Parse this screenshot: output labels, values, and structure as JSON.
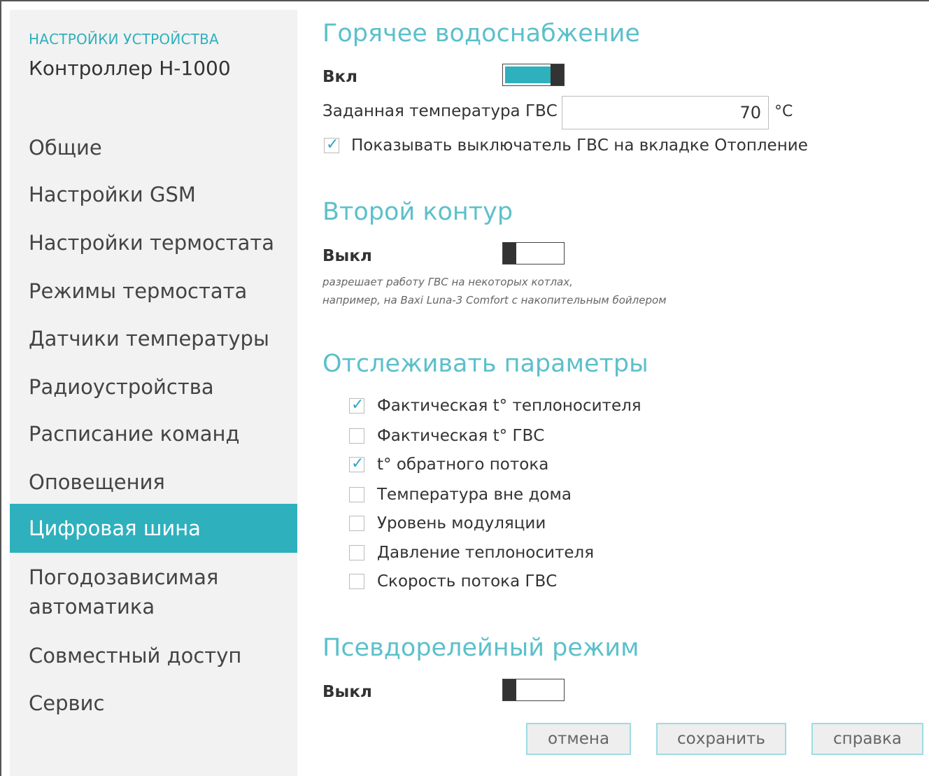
{
  "sidebar": {
    "caption": "НАСТРОЙКИ УСТРОЙСТВА",
    "device": "Контроллер H-1000",
    "items": [
      {
        "label": "Общие"
      },
      {
        "label": "Настройки GSM"
      },
      {
        "label": "Настройки термостата"
      },
      {
        "label": "Режимы термостата"
      },
      {
        "label": "Датчики температуры"
      },
      {
        "label": "Радиоустройства"
      },
      {
        "label": "Расписание команд"
      },
      {
        "label": "Оповещения"
      },
      {
        "label": "Цифровая шина"
      },
      {
        "label_line1": "Погодозависимая",
        "label_line2": "автоматика"
      },
      {
        "label": "Совместный доступ"
      },
      {
        "label": "Сервис"
      }
    ],
    "active_index": 8
  },
  "hot_water": {
    "title": "Горячее водоснабжение",
    "state_label": "Вкл",
    "toggle_on": true,
    "temp_label": "Заданная температура ГВС",
    "temp_value": "70",
    "temp_unit": "°C",
    "show_switch_checked": true,
    "show_switch_label": "Показывать выключатель ГВС на вкладке Отопление"
  },
  "second_circuit": {
    "title": "Второй контур",
    "state_label": "Выкл",
    "toggle_on": false,
    "note_line1": "разрешает работу ГВС на некоторых котлах,",
    "note_line2": "например, на Baxi Luna-3 Comfort с накопительным бойлером"
  },
  "monitor": {
    "title": "Отслеживать параметры",
    "items": [
      {
        "label": "Фактическая t° теплоносителя",
        "checked": true
      },
      {
        "label": "Фактическая t° ГВС",
        "checked": false
      },
      {
        "label": "t° обратного потока",
        "checked": true
      },
      {
        "label": "Температура вне дома",
        "checked": false
      },
      {
        "label": "Уровень модуляции",
        "checked": false
      },
      {
        "label": "Давление теплоносителя",
        "checked": false
      },
      {
        "label": "Скорость потока ГВС",
        "checked": false
      }
    ]
  },
  "pseudo_relay": {
    "title": "Псевдорелейный режим",
    "state_label": "Выкл",
    "toggle_on": false
  },
  "buttons": {
    "cancel": "отмена",
    "save": "сохранить",
    "help": "справка"
  },
  "colors": {
    "accent": "#2fb0bd",
    "heading": "#5cc0cb",
    "sidebar_bg": "#f2f2f2"
  },
  "icons": {
    "check": "check-icon"
  }
}
